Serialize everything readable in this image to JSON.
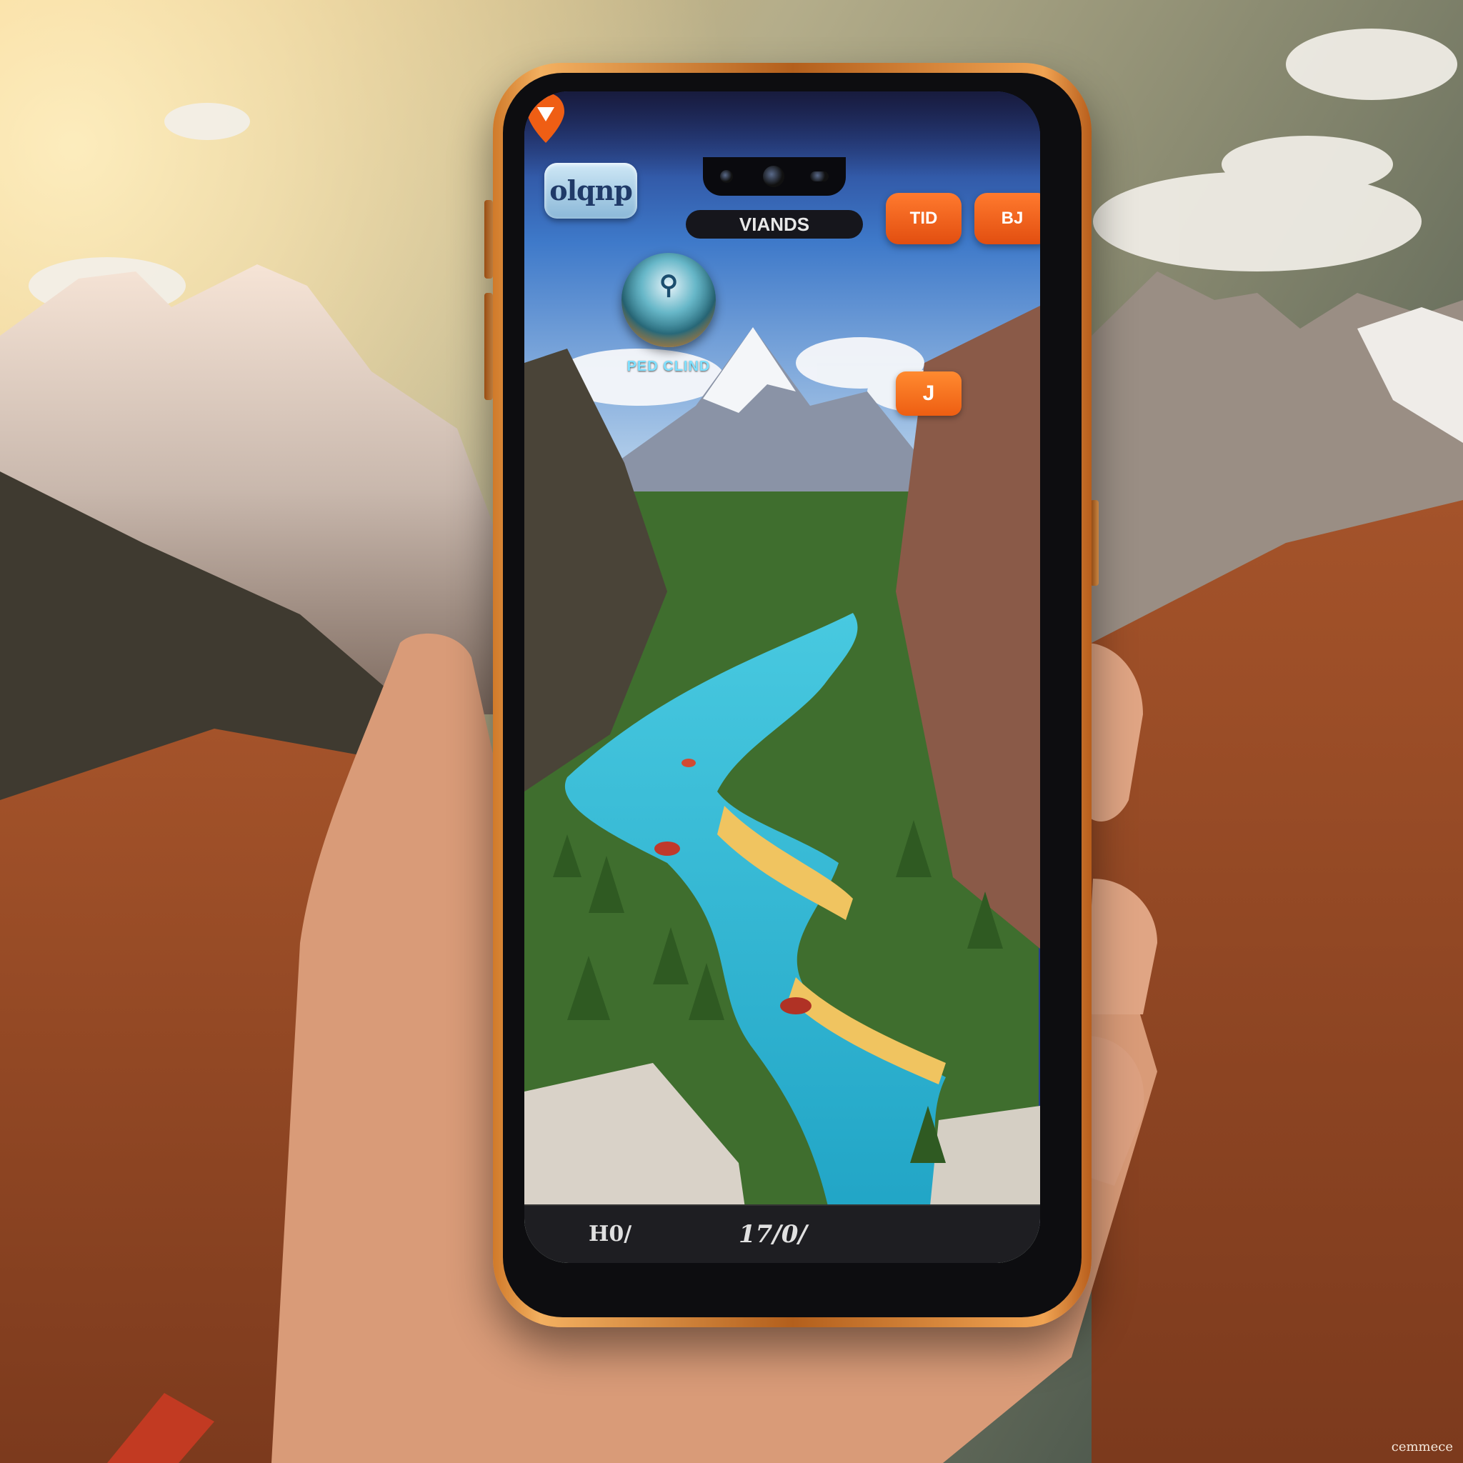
{
  "app": {
    "logo_text": "olqnp",
    "screen_title": "VIANDS"
  },
  "toolbar": {
    "left_button_label": "TID",
    "right_button_label": "BJ"
  },
  "map": {
    "badge_caption": "PED CLIND",
    "chat_bubble_label": "J",
    "compass_icon": "compass-icon",
    "pin_icon": "location-pin-icon"
  },
  "bottom_bar": {
    "left_value": "H0/",
    "center_value": "17/0/"
  },
  "watermark": "cemmece",
  "colors": {
    "accent": "#ef5e14",
    "phone_frame": "#d07a2a",
    "water": "#29b9d6"
  }
}
